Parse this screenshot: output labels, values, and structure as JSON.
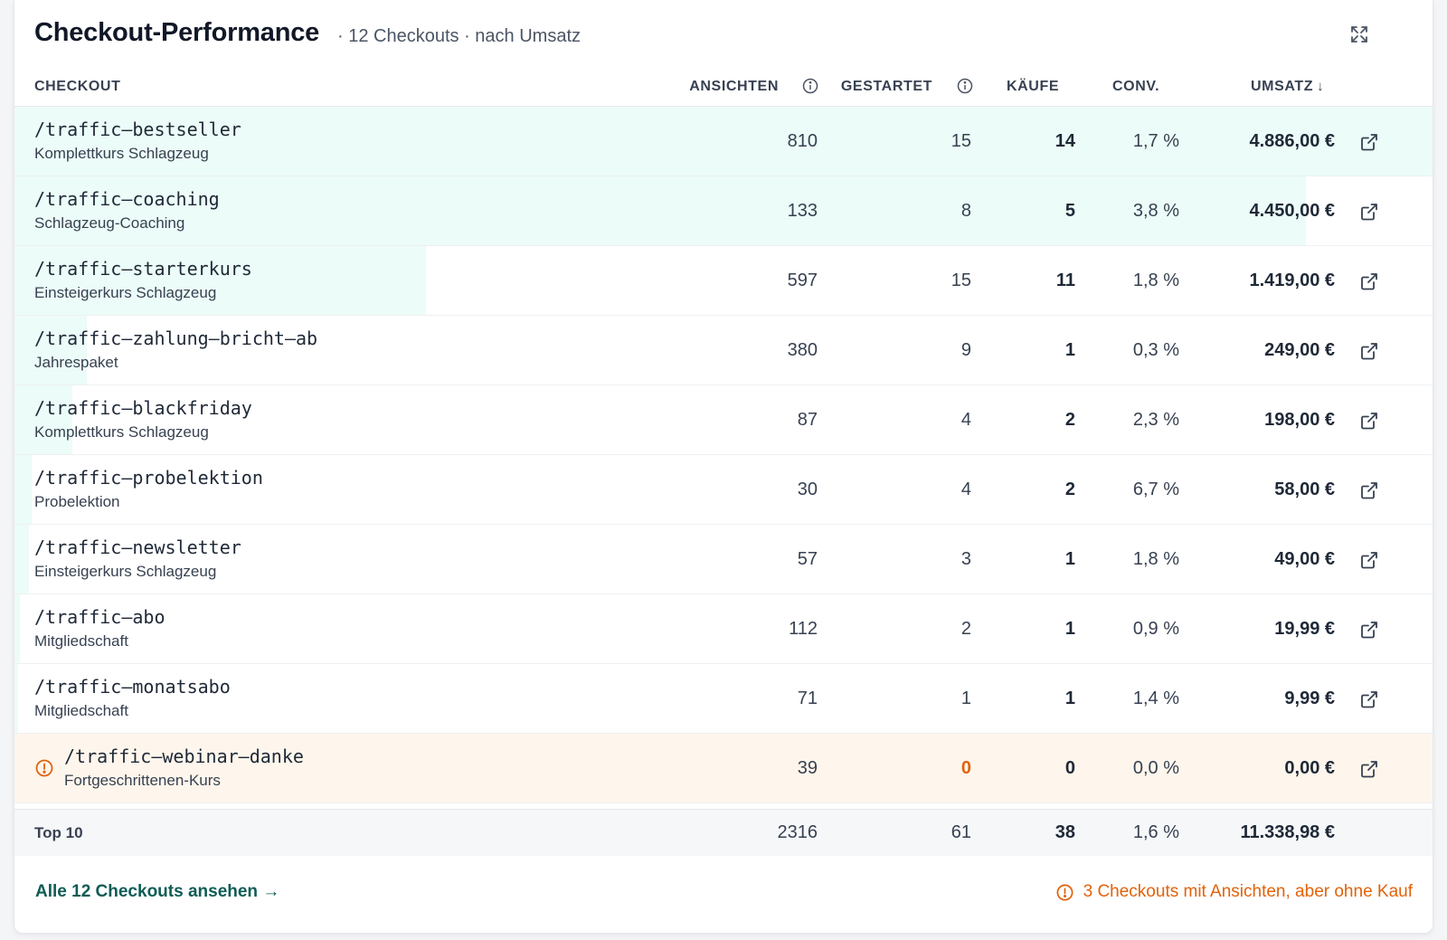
{
  "header": {
    "title": "Checkout-Performance",
    "subtitle": "· 12 Checkouts · nach Umsatz"
  },
  "columns": {
    "checkout": "CHECKOUT",
    "views": "ANSICHTEN",
    "started": "GESTARTET",
    "purchases": "KÄUFE",
    "conv": "CONV.",
    "revenue": "UMSATZ",
    "sort_indicator": "↓"
  },
  "rows": [
    {
      "path": "/traffic–bestseller",
      "product": "Komplettkurs Schlagzeug",
      "views": "810",
      "started": "15",
      "purchases": "14",
      "conv": "1,7 %",
      "revenue": "4.886,00 €",
      "revenue_share": 1.0
    },
    {
      "path": "/traffic–coaching",
      "product": "Schlagzeug-Coaching",
      "views": "133",
      "started": "8",
      "purchases": "5",
      "conv": "3,8 %",
      "revenue": "4.450,00 €",
      "revenue_share": 0.911
    },
    {
      "path": "/traffic–starterkurs",
      "product": "Einsteigerkurs Schlagzeug",
      "views": "597",
      "started": "15",
      "purchases": "11",
      "conv": "1,8 %",
      "revenue": "1.419,00 €",
      "revenue_share": 0.29
    },
    {
      "path": "/traffic–zahlung–bricht–ab",
      "product": "Jahrespaket",
      "views": "380",
      "started": "9",
      "purchases": "1",
      "conv": "0,3 %",
      "revenue": "249,00 €",
      "revenue_share": 0.051
    },
    {
      "path": "/traffic–blackfriday",
      "product": "Komplettkurs Schlagzeug",
      "views": "87",
      "started": "4",
      "purchases": "2",
      "conv": "2,3 %",
      "revenue": "198,00 €",
      "revenue_share": 0.041
    },
    {
      "path": "/traffic–probelektion",
      "product": "Probelektion",
      "views": "30",
      "started": "4",
      "purchases": "2",
      "conv": "6,7 %",
      "revenue": "58,00 €",
      "revenue_share": 0.012
    },
    {
      "path": "/traffic–newsletter",
      "product": "Einsteigerkurs Schlagzeug",
      "views": "57",
      "started": "3",
      "purchases": "1",
      "conv": "1,8 %",
      "revenue": "49,00 €",
      "revenue_share": 0.01
    },
    {
      "path": "/traffic–abo",
      "product": "Mitgliedschaft",
      "views": "112",
      "started": "2",
      "purchases": "1",
      "conv": "0,9 %",
      "revenue": "19,99 €",
      "revenue_share": 0.004
    },
    {
      "path": "/traffic–monatsabo",
      "product": "Mitgliedschaft",
      "views": "71",
      "started": "1",
      "purchases": "1",
      "conv": "1,4 %",
      "revenue": "9,99 €",
      "revenue_share": 0.002
    },
    {
      "path": "/traffic–webinar–danke",
      "product": "Fortgeschrittenen-Kurs",
      "views": "39",
      "started": "0",
      "purchases": "0",
      "conv": "0,0 %",
      "revenue": "0,00 €",
      "revenue_share": 0,
      "warning": true
    }
  ],
  "total": {
    "label": "Top 10",
    "views": "2316",
    "started": "61",
    "purchases": "38",
    "conv": "1,6 %",
    "revenue": "11.338,98 €"
  },
  "footer": {
    "link": "Alle 12 Checkouts ansehen →",
    "warning": "3 Checkouts mit Ansichten, aber ohne Kauf"
  },
  "colors": {
    "bar": "#ecfcf8",
    "warning": "#e2620a",
    "link": "#0f5c55",
    "warn_row": "#fef6ec"
  },
  "icons": {
    "expand": "expand-icon",
    "info": "info-icon",
    "external": "external-link-icon",
    "warning": "warning-circle-icon"
  }
}
